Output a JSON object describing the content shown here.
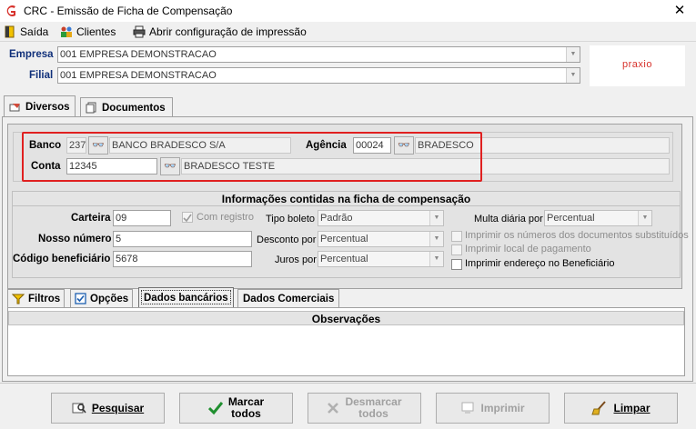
{
  "window": {
    "title": "CRC - Emissão de Ficha de Compensação",
    "close_icon": "close-icon"
  },
  "menu": {
    "exit_label": "Saída",
    "clients_label": "Clientes",
    "print_config_label": "Abrir configuração de impressão"
  },
  "header": {
    "empresa_label": "Empresa",
    "empresa_value": "001 EMPRESA DEMONSTRACAO",
    "filial_label": "Filial",
    "filial_value": "001 EMPRESA DEMONSTRACAO",
    "logo_text": "praxio"
  },
  "main_tabs": [
    {
      "label": "Diversos"
    },
    {
      "label": "Documentos"
    }
  ],
  "bank": {
    "banco_label": "Banco",
    "banco_code": "237",
    "banco_name": "BANCO BRADESCO S/A",
    "agencia_label": "Agência",
    "agencia_code": "00024",
    "agencia_name": "BRADESCO",
    "conta_label": "Conta",
    "conta_code": "12345",
    "conta_name": "BRADESCO TESTE"
  },
  "ficha": {
    "section_title": "Informações contidas na ficha de compensação",
    "carteira_label": "Carteira",
    "carteira_value": "09",
    "com_registro_label": "Com registro",
    "tipo_boleto_label": "Tipo boleto",
    "tipo_boleto_value": "Padrão",
    "multa_label": "Multa diária por",
    "multa_value": "Percentual",
    "nosso_numero_label": "Nosso número",
    "nosso_numero_value": "5",
    "desconto_label": "Desconto por",
    "desconto_value": "Percentual",
    "codigo_label": "Código beneficiário",
    "codigo_value": "5678",
    "juros_label": "Juros por",
    "juros_value": "Percentual",
    "chk_numeros_label": "Imprimir os números dos documentos substituídos",
    "chk_local_label": "Imprimir local de pagamento",
    "chk_endereco_label": "Imprimir endereço no Beneficiário"
  },
  "sub_tabs": [
    {
      "label": "Filtros"
    },
    {
      "label": "Opções"
    },
    {
      "label": "Dados bancários"
    },
    {
      "label": "Dados Comerciais"
    }
  ],
  "observacoes": {
    "title": "Observações"
  },
  "buttons": {
    "pesquisar": "Pesquisar",
    "marcar_1": "Marcar",
    "marcar_2": "todos",
    "desmarcar_1": "Desmarcar",
    "desmarcar_2": "todos",
    "imprimir": "Imprimir",
    "limpar": "Limpar"
  },
  "colors": {
    "highlight": "#e02020",
    "logo": "#d7322c",
    "label_blue": "#10307a"
  }
}
